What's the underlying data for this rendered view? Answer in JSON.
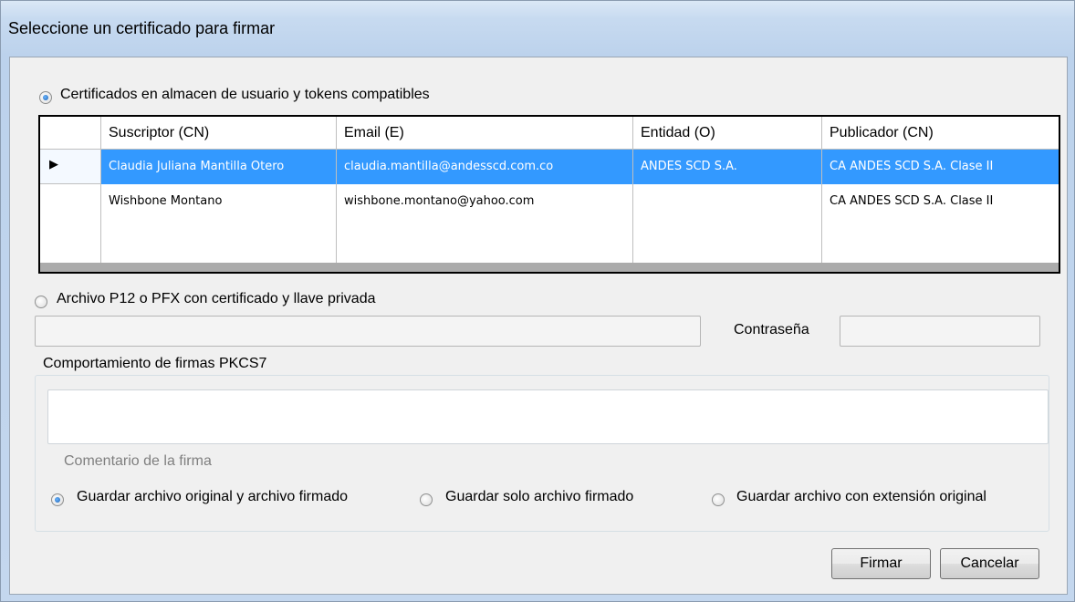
{
  "window": {
    "title": "Seleccione un certificado para firmar"
  },
  "store_option": {
    "label": "Certificados en almacen de usuario y tokens compatibles",
    "checked": true
  },
  "certificates": {
    "columns": [
      "Suscriptor (CN)",
      "Email (E)",
      "Entidad (O)",
      "Publicador (CN)"
    ],
    "rows": [
      {
        "subscriber": "Claudia Juliana Mantilla Otero",
        "email": "claudia.mantilla@andesscd.com.co",
        "entity": "ANDES SCD S.A.",
        "publisher": "CA ANDES SCD S.A. Clase II",
        "selected": true
      },
      {
        "subscriber": "Wishbone Montano",
        "email": "wishbone.montano@yahoo.com",
        "entity": "",
        "publisher": "CA ANDES SCD S.A. Clase II",
        "selected": false
      }
    ],
    "current_row_marker": "▶"
  },
  "file_option": {
    "label": "Archivo P12 o PFX con certificado y llave privada",
    "checked": false,
    "file_value": "",
    "password_label": "Contraseña",
    "password_value": ""
  },
  "pkcs7": {
    "group_title": "Comportamiento de firmas PKCS7",
    "comment_value": "",
    "comment_label": "Comentario de la firma",
    "save_options": [
      {
        "label": "Guardar archivo original y archivo firmado",
        "checked": true
      },
      {
        "label": "Guardar solo archivo firmado",
        "checked": false
      },
      {
        "label": "Guardar archivo con extensión original",
        "checked": false
      }
    ]
  },
  "buttons": {
    "sign": "Firmar",
    "cancel": "Cancelar"
  },
  "colors": {
    "selection": "#3399ff",
    "window_frame": "#c4d7ee",
    "client_bg": "#f0f0f0"
  }
}
